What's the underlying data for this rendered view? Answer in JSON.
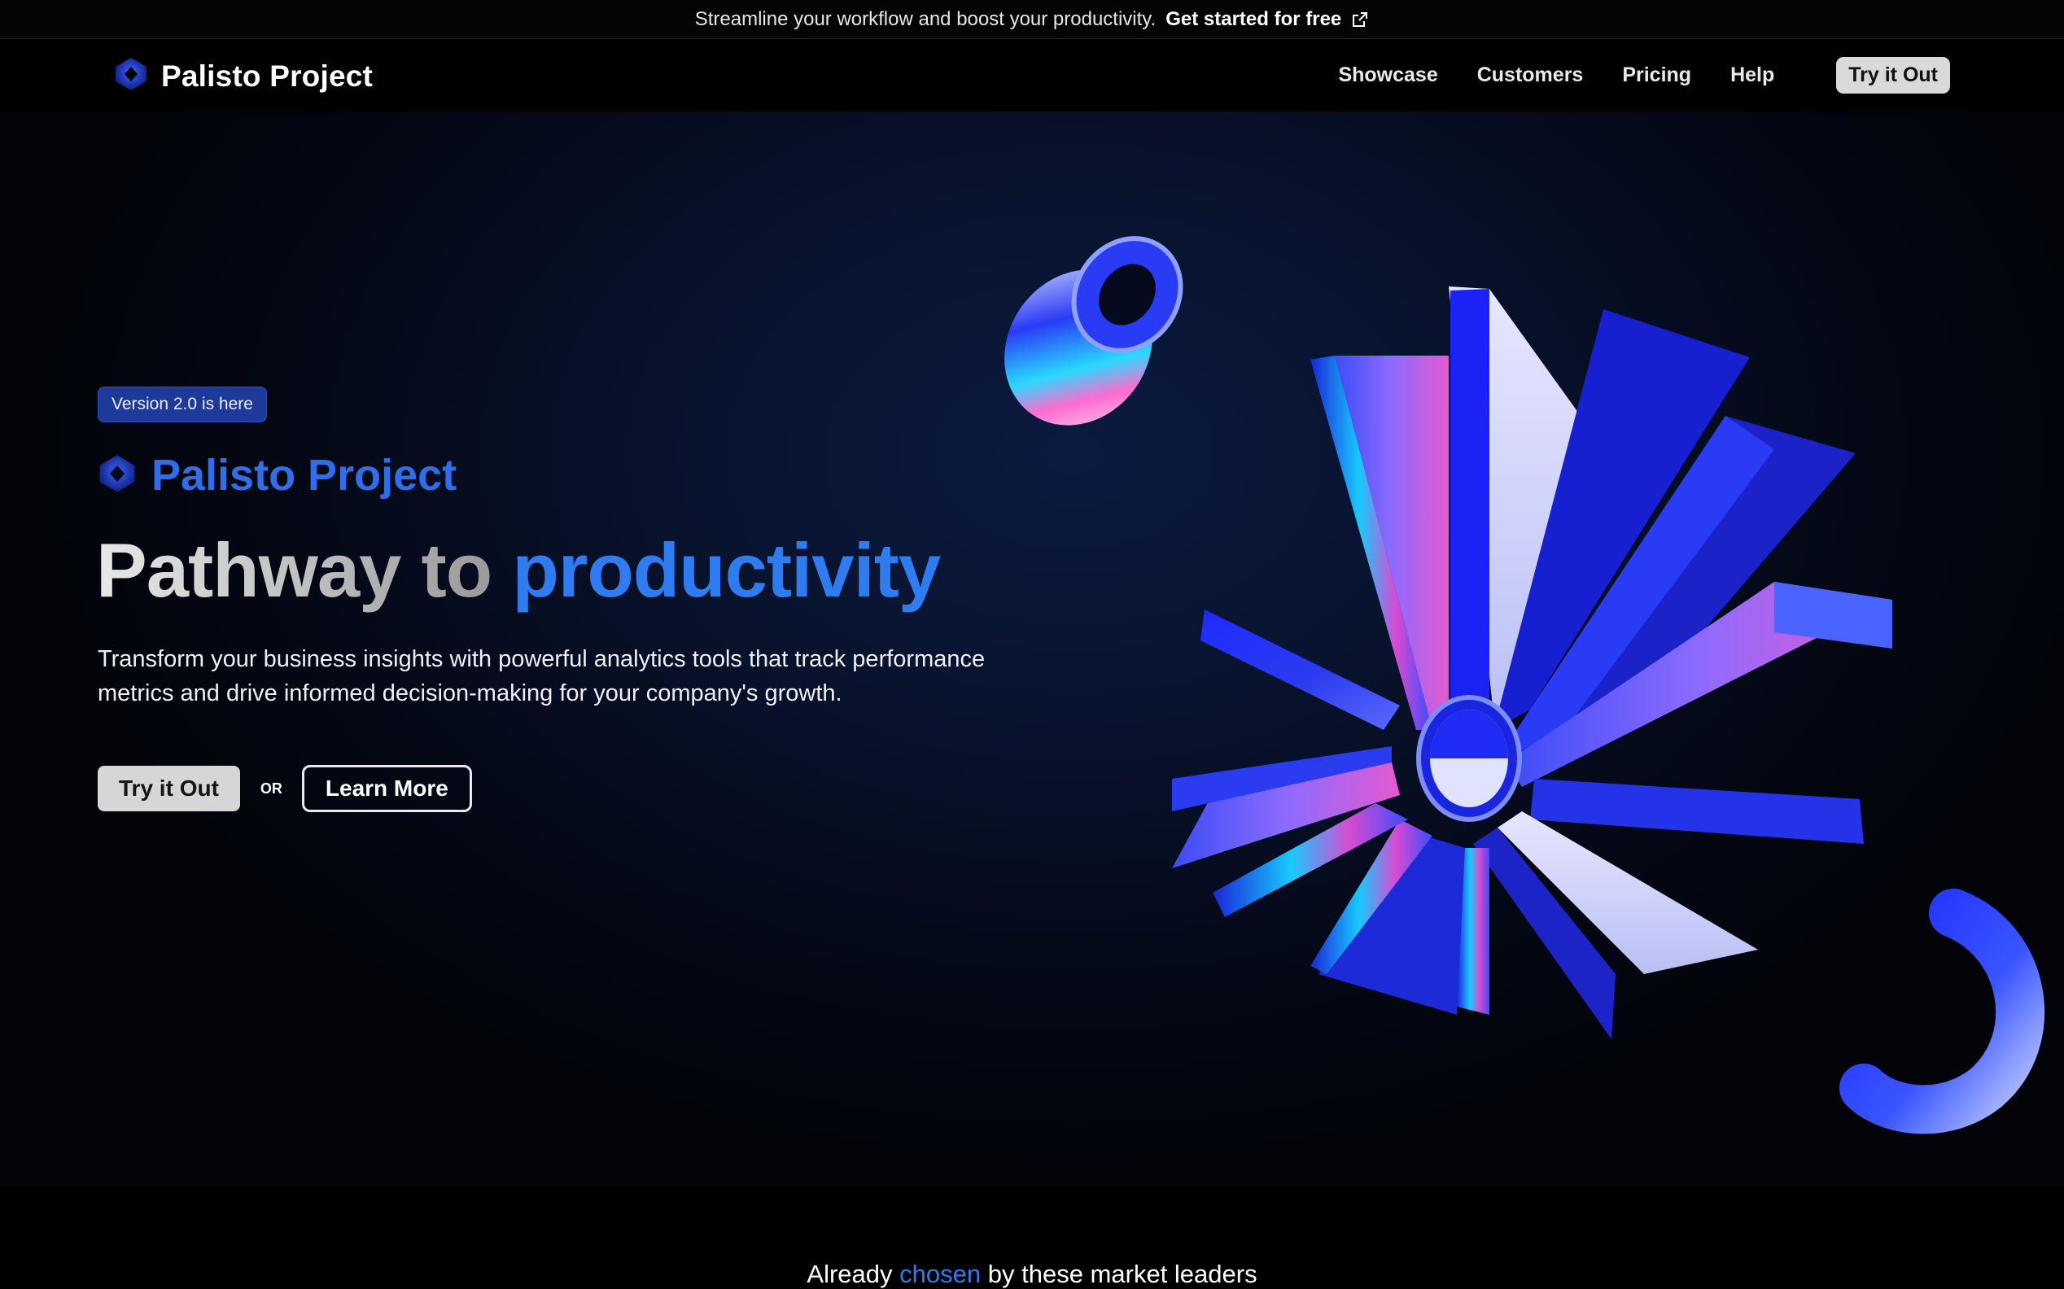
{
  "banner": {
    "text": "Streamline your workflow and boost your productivity.",
    "cta": "Get started for free",
    "cta_icon": "external-link-icon"
  },
  "nav": {
    "brand": "Palisto Project",
    "logo_icon": "diamond-logo-icon",
    "links": [
      "Showcase",
      "Customers",
      "Pricing",
      "Help"
    ],
    "cta": "Try it Out"
  },
  "hero": {
    "badge": "Version 2.0 is here",
    "brand": "Palisto Project",
    "headline_part1": "Pathway to",
    "headline_part2": "productivity",
    "subtext": "Transform your business insights with powerful analytics tools that track performance metrics and drive informed decision-making for your company's growth.",
    "primary_button": "Try it Out",
    "or_label": "OR",
    "secondary_button": "Learn More"
  },
  "leaders": {
    "prefix": "Already",
    "highlight": "chosen",
    "suffix": "by these market leaders"
  },
  "colors": {
    "accent": "#2f7bf0",
    "badge_bg": "#1d3a9a",
    "background": "#000000"
  }
}
